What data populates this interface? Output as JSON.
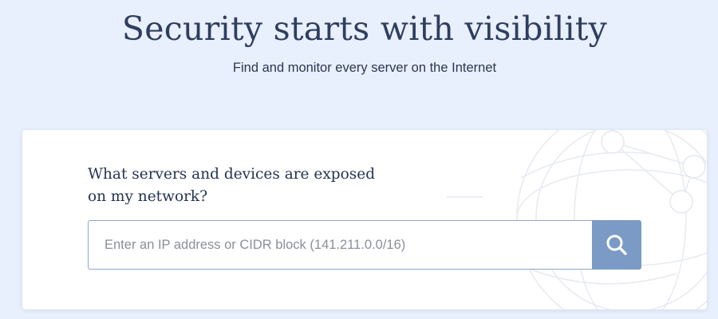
{
  "hero": {
    "title": "Security starts with visibility",
    "subtitle": "Find and monitor every server on the Internet"
  },
  "card": {
    "question_line1": "What servers and devices are exposed",
    "question_line2": "on my network?"
  },
  "search": {
    "placeholder": "Enter an IP address or CIDR block (141.211.0.0/16)",
    "value": "",
    "button_icon": "search-icon"
  },
  "colors": {
    "page_background": "#e8effd",
    "heading": "#2f3e5f",
    "button": "#7b9bc6",
    "input_border": "#8ea7cb"
  }
}
